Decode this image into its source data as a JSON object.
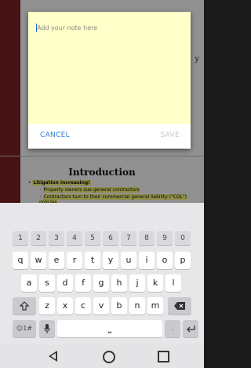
{
  "background_doc": {
    "heading": "Introduction",
    "bullet_main": "Litigation increasing!",
    "sub_bullets": [
      "Property owners sue general contractors",
      "Contractors turn to their commercial general liability (\"CGL\") policies"
    ],
    "side_text": "y"
  },
  "dialog": {
    "placeholder": "Add your note here",
    "cancel_label": "CANCEL",
    "save_label": "SAVE"
  },
  "keyboard": {
    "number_row": [
      "1",
      "2",
      "3",
      "4",
      "5",
      "6",
      "7",
      "8",
      "9",
      "0"
    ],
    "row1": [
      "q",
      "w",
      "e",
      "r",
      "t",
      "y",
      "u",
      "i",
      "o",
      "p"
    ],
    "row2": [
      "a",
      "s",
      "d",
      "f",
      "g",
      "h",
      "j",
      "k",
      "l"
    ],
    "row3": [
      "z",
      "x",
      "c",
      "v",
      "b",
      "n",
      "m"
    ],
    "symbols_label": "☺1#",
    "dot_label": ".",
    "space_glyph": "⎵"
  }
}
